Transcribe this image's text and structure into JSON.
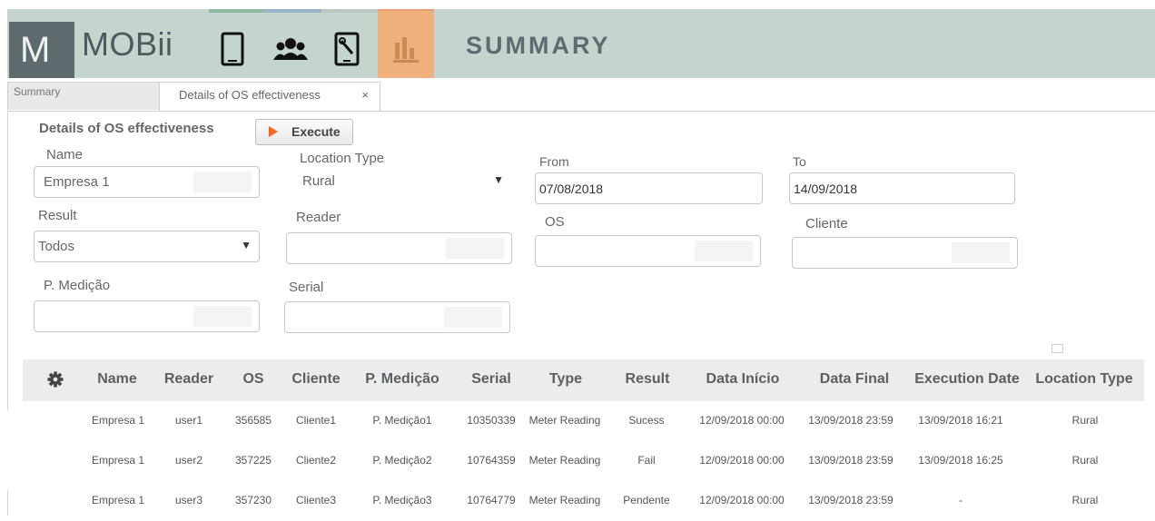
{
  "header": {
    "brand": "MOBii",
    "logo_letter": "M",
    "title": "SUMMARY",
    "nav": [
      {
        "icon": "tablet-icon"
      },
      {
        "icon": "users-icon"
      },
      {
        "icon": "device-settings-icon"
      },
      {
        "icon": "bar-chart-icon",
        "active": true
      }
    ],
    "colors": {
      "header_bg": "#c3d5cd",
      "active_nav": "#f0b07d",
      "logo_bg": "#5d6a6e"
    }
  },
  "tabs": [
    {
      "label": "Summary"
    },
    {
      "label": "Details of OS effectiveness",
      "close": "×"
    }
  ],
  "form": {
    "title": "Details of OS effectiveness",
    "execute_label": "Execute",
    "name": {
      "label": "Name",
      "value": "Empresa 1"
    },
    "location_type": {
      "label": "Location Type",
      "value": "Rural",
      "caret": "▼"
    },
    "from": {
      "label": "From",
      "value": "07/08/2018"
    },
    "to": {
      "label": "To",
      "value": "14/09/2018"
    },
    "result": {
      "label": "Result",
      "value": "Todos",
      "caret": "▼"
    },
    "reader": {
      "label": "Reader",
      "value": ""
    },
    "os": {
      "label": "OS",
      "value": ""
    },
    "cliente": {
      "label": "Cliente",
      "value": ""
    },
    "p_medicao": {
      "label": "P. Medição",
      "value": ""
    },
    "serial": {
      "label": "Serial",
      "value": ""
    }
  },
  "table": {
    "settings_icon": "gear-icon",
    "columns": [
      "Name",
      "Reader",
      "OS",
      "Cliente",
      "P. Medição",
      "Serial",
      "Type",
      "Result",
      "Data Início",
      "Data Final",
      "Execution Date",
      "Location Type"
    ],
    "rows": [
      [
        "Empresa 1",
        "user1",
        "356585",
        "Cliente1",
        "P. Medição1",
        "10350339",
        "Meter Reading",
        "Sucess",
        "12/09/2018 00:00",
        "13/09/2018 23:59",
        "13/09/2018 16:21",
        "Rural"
      ],
      [
        "Empresa 1",
        "user2",
        "357225",
        "Cliente2",
        "P. Medição2",
        "10764359",
        "Meter Reading",
        "Fail",
        "12/09/2018 00:00",
        "13/09/2018 23:59",
        "13/09/2018 16:25",
        "Rural"
      ],
      [
        "Empresa 1",
        "user3",
        "357230",
        "Cliente3",
        "P. Medição3",
        "10764779",
        "Meter Reading",
        "Pendente",
        "12/09/2018 00:00",
        "13/09/2018 23:59",
        "-",
        "Rural"
      ]
    ]
  }
}
